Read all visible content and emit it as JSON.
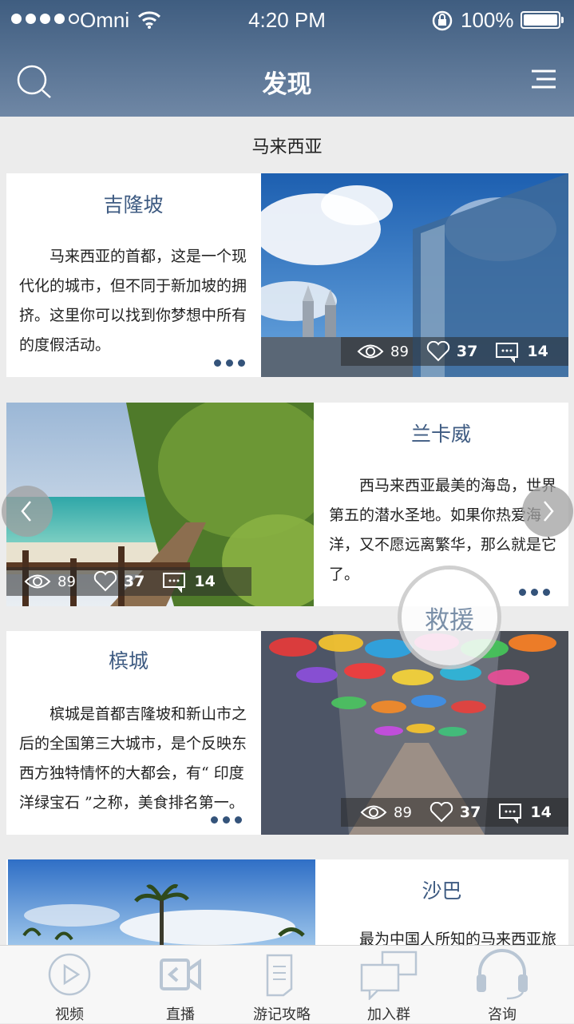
{
  "status_bar": {
    "carrier": "Omni",
    "time": "4:20 PM",
    "battery": "100%"
  },
  "header": {
    "title": "发现"
  },
  "section": {
    "title": "马来西亚"
  },
  "cards": [
    {
      "title": "吉隆坡",
      "description": "马来西亚的首都，这是一个现代化的城市，但不同于新加坡的拥挤。这里你可以找到你梦想中所有的度假活动。",
      "views": "89",
      "likes": "37",
      "comments": "14"
    },
    {
      "title": "兰卡威",
      "description": "西马来西亚最美的海岛，世界第五的潜水圣地。如果你热爱海洋，又不愿远离繁华，那么就是它了。",
      "views": "89",
      "likes": "37",
      "comments": "14"
    },
    {
      "title": "槟城",
      "description": "槟城是首都吉隆坡和新山市之后的全国第三大城市，是个反映东西方独特情怀的大都会，有“ 印度洋绿宝石 ”之称，美食排名第一。",
      "views": "89",
      "likes": "37",
      "comments": "14"
    },
    {
      "title": "沙巴",
      "description": "最为中国人所知的马来西亚旅"
    }
  ],
  "floating_button": {
    "label": "救援"
  },
  "tabbar": {
    "items": [
      {
        "label": "视频",
        "icon": "play-icon"
      },
      {
        "label": "直播",
        "icon": "camera-icon"
      },
      {
        "label": "游记攻略",
        "icon": "document-icon"
      },
      {
        "label": "加入群",
        "icon": "chat-icon"
      },
      {
        "label": "咨询",
        "icon": "headset-icon"
      }
    ]
  },
  "colors": {
    "header": "#4e6a8e",
    "accent": "#3e5b82"
  }
}
